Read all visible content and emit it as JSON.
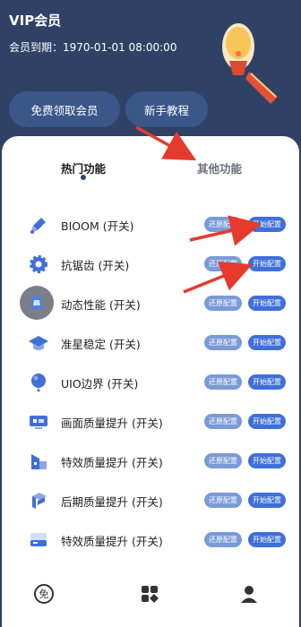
{
  "header": {
    "title": "VIP会员",
    "expiry": "会员到期：1970-01-01 08:00:00",
    "buttons": {
      "free": "免费领取会员",
      "tutorial": "新手教程"
    }
  },
  "tabs": {
    "hot": "热门功能",
    "other": "其他功能"
  },
  "features": [
    {
      "label": "BIOOM (开关)",
      "icon": "bloom-icon"
    },
    {
      "label": "抗锯齿 (开关)",
      "icon": "gear-icon"
    },
    {
      "label": "动态性能 (开关)",
      "icon": "performance-icon"
    },
    {
      "label": "准星稳定 (开关)",
      "icon": "graduation-cap-icon"
    },
    {
      "label": "UIO边界 (开关)",
      "icon": "balloon-icon"
    },
    {
      "label": "画面质量提升 (开关)",
      "icon": "screen-quality-icon"
    },
    {
      "label": "特效质量提升 (开关)",
      "icon": "building-icon"
    },
    {
      "label": "后期质量提升 (开关)",
      "icon": "post-process-icon"
    },
    {
      "label": "特效质量提升 (开关)",
      "icon": "card-icon"
    }
  ],
  "buttons": {
    "restore": "还原配置",
    "start": "开始配置"
  },
  "colors": {
    "header_bg": "#2f4266",
    "accent": "#3f6fd9",
    "restore": "#7a9ad8",
    "arrow": "#e53a2c"
  },
  "nav": [
    "free-icon",
    "apps-icon",
    "user-icon"
  ]
}
